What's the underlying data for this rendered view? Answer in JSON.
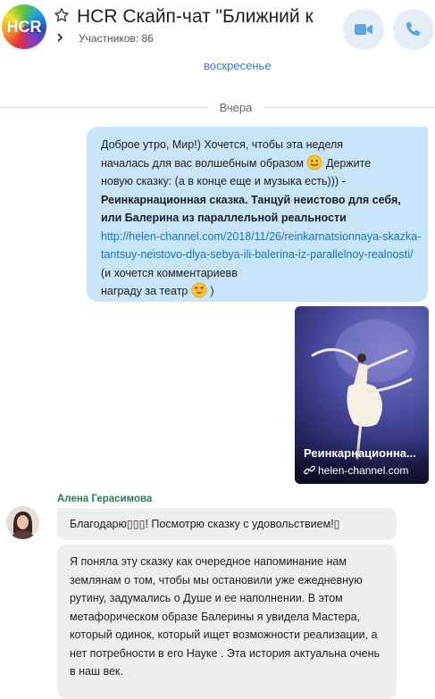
{
  "header": {
    "avatar_text": "HCR",
    "title": "HCR Скайп-чат \"Ближний к",
    "participants": "Участников: 86"
  },
  "chat": {
    "previous_day_label": "воскресенье",
    "date_separator": "Вчера",
    "outgoing": {
      "line1": "Доброе утро, Мир!) Хочется, чтобы эта неделя",
      "line2": "началась для вас волшебным образом",
      "line2b": "Держите",
      "line3": "новую сказку:  (а в конце еще и музыка есть))) -",
      "bold": "Реинкарнационная сказка. Танцуй неистово для себя, или Балерина из параллельной реальности",
      "link": "http://helen-channel.com/2018/11/26/reinkarnatsionnaya-skazka-tantsuy-neistovo-dlya-sebya-ili-balerina-iz-parallelnoy-realnosti/",
      "tail1": "(и хочется комментариевв",
      "tail2": "награду за театр",
      "tail3": ")"
    },
    "media": {
      "title": "Реинкарнационна...",
      "site": "helen-channel.com"
    },
    "incoming": {
      "sender": "Алена Герасимова",
      "message1": "Благодарю▯▯▯! Посмотрю сказку с удовольствием!▯",
      "message2": "Я поняла эту сказку как  очередное напоминание нам землянам   о том, чтобы мы остановили уже ежедневную рутину, задумались о Душе и ее наполнении. В этом  метафорическом образе Балерины я увидела Мастера, который одинок, который ищет возможности реализации, а нет потребности в его Науке . Эта история актуальна очень в наш век."
    }
  },
  "colors": {
    "outgoing_bubble": "#c7e4f9",
    "incoming_bubble": "#eeeeee",
    "link": "#1f74b8",
    "sender_name": "#2f7a52",
    "header_button_bg": "#e5eef7",
    "header_button_icon": "#5aa6e6"
  },
  "icons": [
    "star-icon",
    "chevron-right-icon",
    "video-call-icon",
    "phone-call-icon",
    "link-icon",
    "smile-emoji-icon",
    "heart-eyes-emoji-icon"
  ]
}
